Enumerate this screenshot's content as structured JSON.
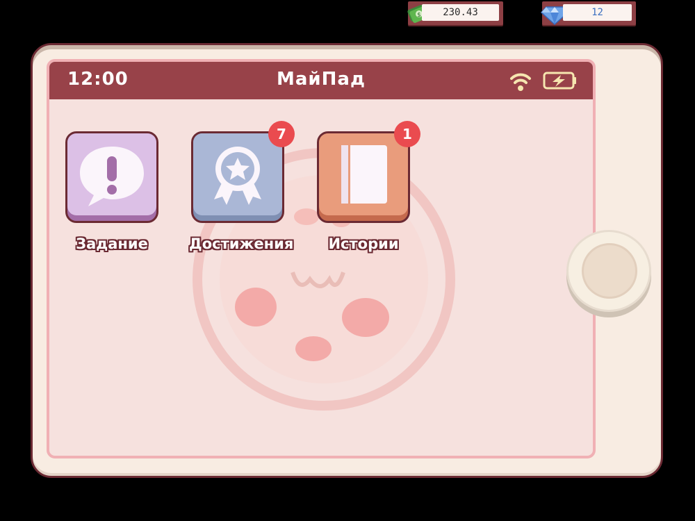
{
  "currency": {
    "cash": "230.43",
    "gems": "12"
  },
  "tablet": {
    "time": "12:00",
    "title": "МайПад"
  },
  "apps": [
    {
      "label": "Задание",
      "icon": "exclamation-bubble-icon",
      "badge": ""
    },
    {
      "label": "Достижения",
      "icon": "medal-star-icon",
      "badge": "7"
    },
    {
      "label": "Истории",
      "icon": "book-icon",
      "badge": "1"
    }
  ],
  "colors": {
    "status_bar": "#984249",
    "badge": "#ea4b4f",
    "tasks_tile": "#dcc0e6",
    "achievements_tile": "#aab7d6",
    "stories_tile": "#e99c7c"
  }
}
